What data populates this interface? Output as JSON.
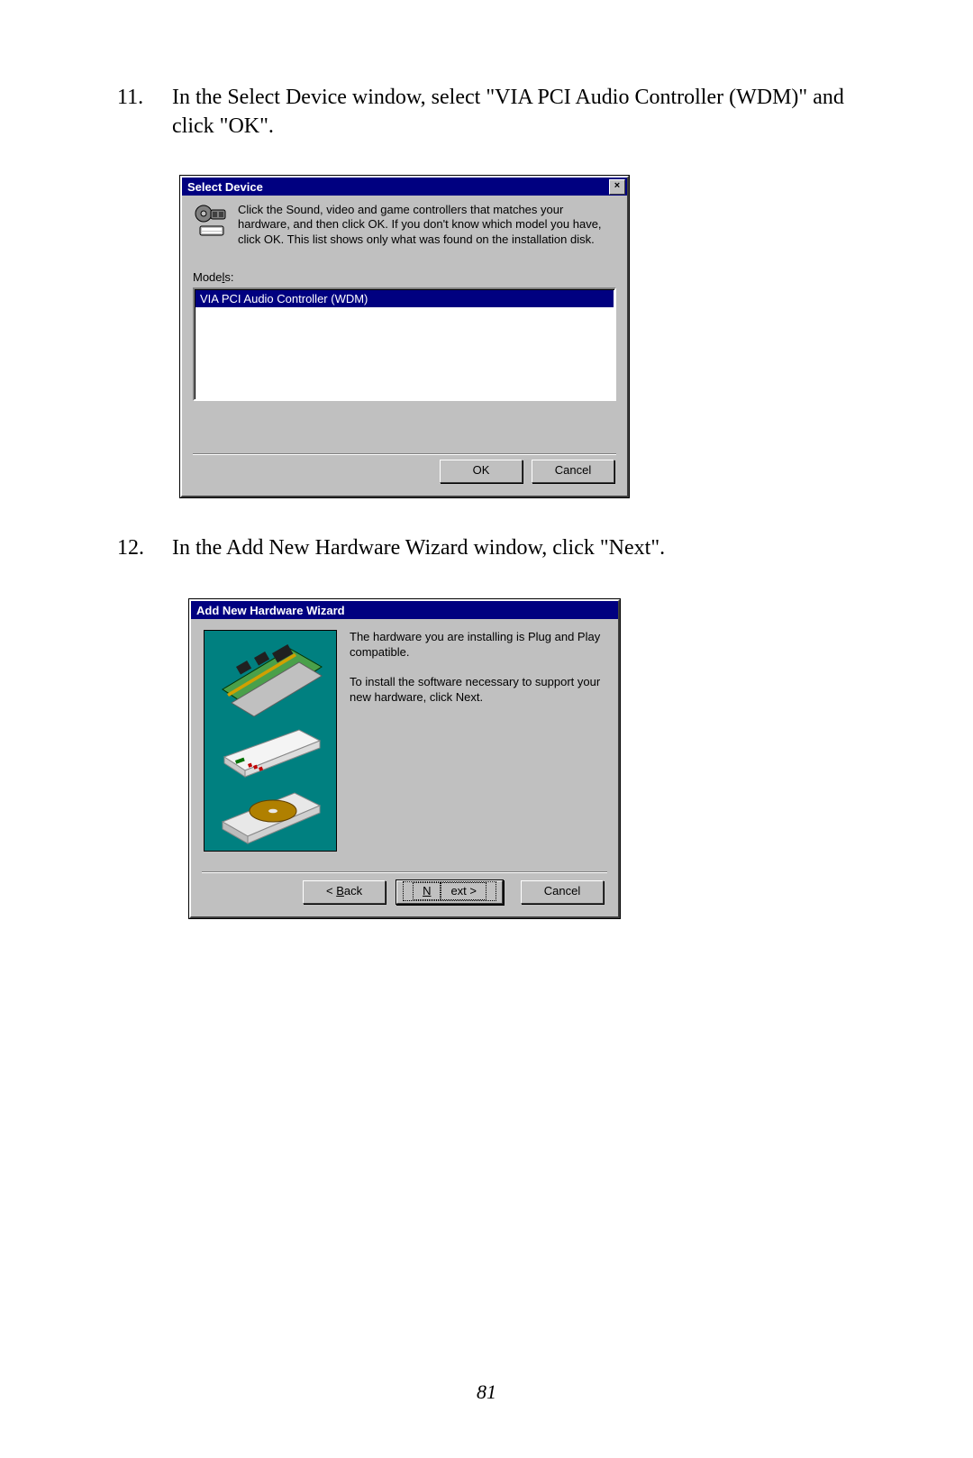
{
  "steps": {
    "s11": {
      "num": "11.",
      "text": "In the Select Device window, select \"VIA PCI Audio Controller (WDM)\" and click \"OK\"."
    },
    "s12": {
      "num": "12.",
      "text": "In the Add New Hardware Wizard window, click \"Next\"."
    }
  },
  "selectDevice": {
    "title": "Select Device",
    "close": "×",
    "instruction": "Click the Sound, video and game controllers that matches your hardware, and then click OK. If you don't know which model you have, click OK. This list shows only what was found on the installation disk.",
    "modelsLabel_pre": "Mode",
    "modelsLabel_ul": "l",
    "modelsLabel_post": "s:",
    "selected": "VIA PCI Audio Controller (WDM)",
    "ok": "OK",
    "cancel": "Cancel"
  },
  "wizard": {
    "title": "Add New Hardware Wizard",
    "p1": "The hardware you are installing is Plug and Play compatible.",
    "p2": "To install the software necessary to support your new hardware, click Next.",
    "back_pre": "< ",
    "back_ul": "B",
    "back_post": "ack",
    "next_pre": "",
    "next_ul": "N",
    "next_post": "ext >",
    "cancel": "Cancel"
  },
  "pageNumber": "81"
}
